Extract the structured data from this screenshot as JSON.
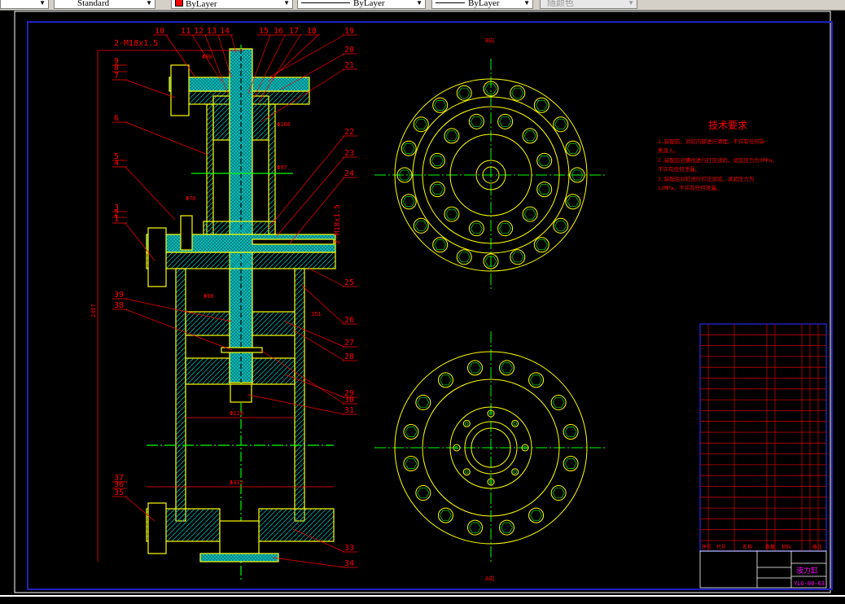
{
  "toolbar": {
    "text_style": "Standard",
    "color": "ByLayer",
    "linetype": "ByLayer",
    "lineweight": "ByLayer",
    "plot_style": "随颜色",
    "color_swatch": "#ff0000"
  },
  "drawing": {
    "colors": {
      "outline": "#ffff00",
      "section": "#00c8c8",
      "centerline": "#00ff00",
      "annotation": "#ff0000",
      "frame": "#0000cc",
      "title_text": "#ff00ff"
    },
    "top_labels": [
      "10",
      "11",
      "12",
      "13",
      "14",
      "15",
      "16",
      "17",
      "18"
    ],
    "right_labels": [
      "19",
      "20",
      "21",
      "22",
      "23",
      "24",
      "25",
      "26",
      "27",
      "28",
      "29",
      "30",
      "31",
      "33",
      "34"
    ],
    "left_labels": [
      "9",
      "8",
      "7",
      "6",
      "5",
      "4",
      "3",
      "2",
      "1",
      "39",
      "38",
      "37",
      "36",
      "35"
    ],
    "thread_note": "2-M18x1.5",
    "dimensions": [
      "Φ80",
      "Φ160",
      "Φ97",
      "Φ70",
      "Φ80",
      "Φ220",
      "Φ332",
      "351",
      "2467"
    ],
    "view_labels": [
      "B向",
      "A向"
    ],
    "tech_requirements": {
      "title": "技术要求",
      "lines": [
        "1.装配前，对缸内部进行清理，不许有任何杂",
        "质混入。",
        "2.装配后对螺纹进行打压试验，试验压力为3MPa，",
        "不许有任何泄漏。",
        "3.装配后对缸进行打压试验，试验压力为",
        "12MPa，不许有任何泄漏。"
      ]
    },
    "parts_table": {
      "headers": [
        "序号",
        "代号",
        "名称",
        "数量",
        "材料",
        "备注"
      ]
    },
    "title_block": {
      "name": "液力缸",
      "drawing_no": "YLG-00-03"
    }
  }
}
